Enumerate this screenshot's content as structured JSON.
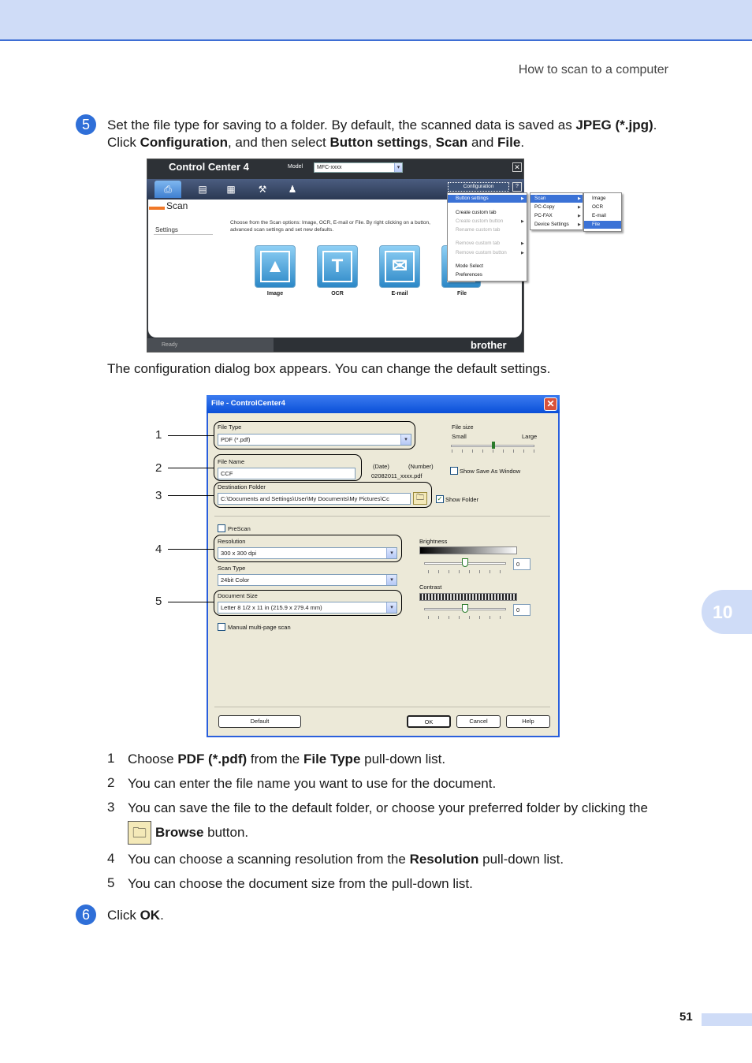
{
  "header": {
    "title": "How to scan to a computer",
    "chapter": "10",
    "page_number": "51"
  },
  "steps": {
    "step5": {
      "badge": "5",
      "line1": {
        "a": "Set the file type for saving to a folder. By default, the scanned data is saved as ",
        "b": "JPEG (*.jpg)",
        "c": "."
      },
      "line2": {
        "a": "Click ",
        "b": "Configuration",
        "c": ", and then select ",
        "d": "Button settings",
        "e": ", ",
        "f": "Scan",
        "g": " and ",
        "h": "File",
        "i": "."
      }
    },
    "after_screenshot": "The configuration dialog box appears. You can change the default settings.",
    "step6": {
      "badge": "6",
      "a": "Click ",
      "b": "OK",
      "c": "."
    }
  },
  "cc4": {
    "title": "Control Center 4",
    "model_label": "Model",
    "model_value": "MFC-xxxx",
    "close": "✕",
    "tab": "Scan",
    "settings": "Settings",
    "description": "Choose from the Scan options: Image, OCR, E-mail or File. By right clicking on a button, advanced scan settings and set new defaults.",
    "buttons": [
      {
        "label": "Image",
        "glyph": "▲"
      },
      {
        "label": "OCR",
        "glyph": "T"
      },
      {
        "label": "E-mail",
        "glyph": "✉"
      },
      {
        "label": "File",
        "glyph": ""
      }
    ],
    "status": "Ready",
    "brand": "brother",
    "configuration": "Configuration",
    "help": "?",
    "menu_main": [
      {
        "label": "Button settings",
        "state": "sel"
      },
      {
        "label": "Create custom tab",
        "state": ""
      },
      {
        "label": "Create custom button",
        "state": "dis"
      },
      {
        "label": "Rename custom tab",
        "state": "dis"
      },
      {
        "label": "Remove custom tab",
        "state": "dis"
      },
      {
        "label": "Remove custom button",
        "state": "dis"
      },
      {
        "label": "Mode Select",
        "state": ""
      },
      {
        "label": "Preferences",
        "state": ""
      }
    ],
    "menu_sub": [
      "Scan",
      "PC-Copy",
      "PC-FAX",
      "Device Settings"
    ],
    "menu_target": [
      "Image",
      "OCR",
      "E-mail",
      "File"
    ]
  },
  "dialog": {
    "title": "File - ControlCenter4",
    "close": "✕",
    "file_type_label": "File Type",
    "file_type_value": "PDF (*.pdf)",
    "file_size_label": "File size",
    "file_size_small": "Small",
    "file_size_large": "Large",
    "file_name_label": "File Name",
    "file_name_value": "CCF",
    "date_label": "(Date)",
    "number_label": "(Number)",
    "name_example": "02082011_xxxx.pdf",
    "show_save_as": "Show Save As Window",
    "dest_folder_label": "Destination Folder",
    "dest_folder_value": "C:\\Documents and Settings\\User\\My Documents\\My Pictures\\Cc",
    "show_folder": "Show Folder",
    "check": "✓",
    "prescan": "PreScan",
    "resolution_label": "Resolution",
    "resolution_value": "300 x 300 dpi",
    "scan_type_label": "Scan Type",
    "scan_type_value": "24bit Color",
    "doc_size_label": "Document Size",
    "doc_size_value": "Letter 8 1/2 x 11 in (215.9 x 279.4 mm)",
    "manual_multipage": "Manual multi-page scan",
    "brightness_label": "Brightness",
    "brightness_value": "0",
    "contrast_label": "Contrast",
    "contrast_value": "0",
    "default_btn": "Default",
    "ok_btn": "OK",
    "cancel_btn": "Cancel",
    "help_btn": "Help",
    "dropdown_arrow": "▾"
  },
  "callouts": [
    "1",
    "2",
    "3",
    "4",
    "5"
  ],
  "list": [
    {
      "num": "1",
      "a": "Choose ",
      "b": "PDF (*.pdf)",
      "c": " from the ",
      "d": "File Type",
      "e": " pull-down list."
    },
    {
      "num": "2",
      "a": "You can enter the file name you want to use for the document."
    },
    {
      "num": "3",
      "a": "You can save the file to the default folder, or choose your preferred folder by clicking the",
      "b": "Browse",
      "c": " button."
    },
    {
      "num": "4",
      "a": "You can choose a scanning resolution from the ",
      "b": "Resolution",
      "c": " pull-down list."
    },
    {
      "num": "5",
      "a": "You can choose the document size from the pull-down list."
    }
  ]
}
